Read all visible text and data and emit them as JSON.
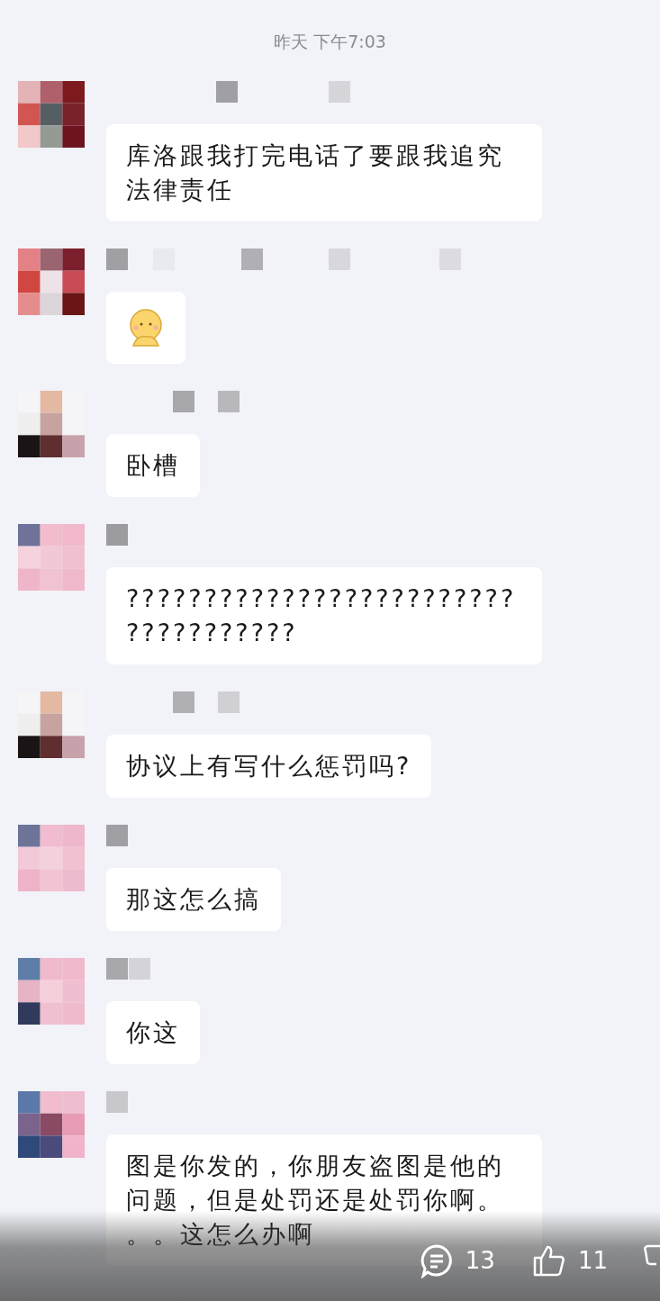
{
  "timestamp": "昨天 下午7:03",
  "messages": [
    {
      "kind": "text",
      "text": "库洛跟我打完电话了要跟我追究法律责任"
    },
    {
      "kind": "emoji"
    },
    {
      "kind": "text",
      "text": "卧槽"
    },
    {
      "kind": "text",
      "text": "????????????????????????????????????"
    },
    {
      "kind": "text",
      "text": "协议上有写什么惩罚吗?"
    },
    {
      "kind": "text",
      "text": "那这怎么搞"
    },
    {
      "kind": "text",
      "text": "你这"
    },
    {
      "kind": "text",
      "text": "图是你发的，你朋友盗图是他的问题，但是处罚还是处罚你啊。。。这怎么办啊"
    }
  ],
  "actions": {
    "comments": "13",
    "likes": "11"
  }
}
